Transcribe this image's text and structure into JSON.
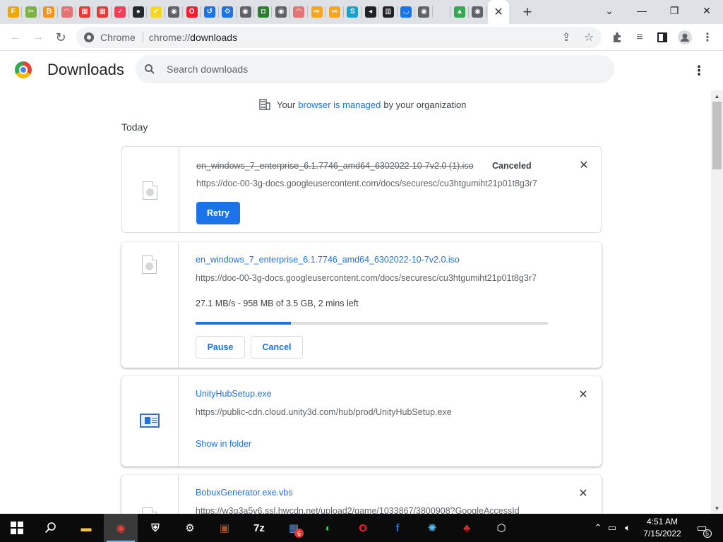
{
  "tabs": [
    {
      "icon": "yellow-f-favicon",
      "color": "#f2a600",
      "glyph": "F"
    },
    {
      "icon": "tools-favicon",
      "color": "#7cb342",
      "glyph": "✂"
    },
    {
      "icon": "bitcoin-favicon",
      "color": "#f7931a",
      "glyph": "₿"
    },
    {
      "icon": "rainbow-favicon",
      "color": "#e57373",
      "glyph": "◠"
    },
    {
      "icon": "calendar-favicon",
      "color": "#e53935",
      "glyph": "▦"
    },
    {
      "icon": "calendar-favicon",
      "color": "#e53935",
      "glyph": "▦"
    },
    {
      "icon": "pocket-favicon",
      "color": "#ef4056",
      "glyph": "✓"
    },
    {
      "icon": "github-favicon",
      "color": "#24292e",
      "glyph": "●"
    },
    {
      "icon": "check-favicon",
      "color": "#f9d71c",
      "glyph": "✔"
    },
    {
      "icon": "globe-favicon",
      "color": "#5f6368",
      "glyph": "◉"
    },
    {
      "icon": "opera-favicon",
      "color": "#ff1b2d",
      "glyph": "O"
    },
    {
      "icon": "history-favicon",
      "color": "#1a73e8",
      "glyph": "↺"
    },
    {
      "icon": "settings-favicon",
      "color": "#1a73e8",
      "glyph": "⚙"
    },
    {
      "icon": "globe-favicon",
      "color": "#5f6368",
      "glyph": "◉"
    },
    {
      "icon": "camera-favicon",
      "color": "#2e7d32",
      "glyph": "◘"
    },
    {
      "icon": "globe-favicon",
      "color": "#5f6368",
      "glyph": "◉"
    },
    {
      "icon": "rainbow-favicon",
      "color": "#e57373",
      "glyph": "◠"
    },
    {
      "icon": "arrow-favicon",
      "color": "#f5a623",
      "glyph": "⇨"
    },
    {
      "icon": "arrow-favicon",
      "color": "#f5a623",
      "glyph": "⇨"
    },
    {
      "icon": "s-favicon",
      "color": "#1aa3c9",
      "glyph": "S"
    },
    {
      "icon": "speaker-favicon",
      "color": "#202124",
      "glyph": "◂"
    },
    {
      "icon": "building-favicon",
      "color": "#202124",
      "glyph": "▥"
    },
    {
      "icon": "arc-favicon",
      "color": "#1a73e8",
      "glyph": "◡"
    },
    {
      "icon": "globe-favicon",
      "color": "#5f6368",
      "glyph": "◉"
    },
    {
      "icon": "blank-favicon",
      "color": "#dee1e6",
      "glyph": ""
    },
    {
      "icon": "drive-favicon",
      "color": "#34a853",
      "glyph": "▲"
    },
    {
      "icon": "globe-favicon",
      "color": "#5f6368",
      "glyph": "◉"
    }
  ],
  "toolbar": {
    "back_icon": "←",
    "forward_icon": "→",
    "reload_icon": "↻",
    "chip_label": "Chrome",
    "url_scheme": "chrome://",
    "url_path": "downloads"
  },
  "downloads": {
    "title": "Downloads",
    "search_placeholder": "Search downloads",
    "managed_prefix": "Your",
    "managed_link": "browser is managed",
    "managed_suffix": "by your organization",
    "section_today": "Today",
    "items": [
      {
        "name": "en_windows_7_enterprise_6.1.7746_amd64_6302022-10-7v2.0 (1).iso",
        "status": "Canceled",
        "url": "https://doc-00-3g-docs.googleusercontent.com/docs/securesc/cu3htgumiht21p01t8g3r7",
        "action": "Retry"
      },
      {
        "name": "en_windows_7_enterprise_6.1.7746_amd64_6302022-10-7v2.0.iso",
        "url": "https://doc-00-3g-docs.googleusercontent.com/docs/securesc/cu3htgumiht21p01t8g3r7",
        "progress_text": "27.1 MB/s - 958 MB of 3.5 GB, 2 mins left",
        "progress_fraction": 0.27,
        "pause": "Pause",
        "cancel": "Cancel"
      },
      {
        "name": "UnityHubSetup.exe",
        "url": "https://public-cdn.cloud.unity3d.com/hub/prod/UnityHubSetup.exe",
        "action": "Show in folder"
      },
      {
        "name": "BobuxGenerator.exe.vbs",
        "url": "https://w3g3a5v6.ssl.hwcdn.net/upload2/game/1033867/3800908?GoogleAccessId"
      }
    ]
  },
  "taskbar": {
    "apps": [
      {
        "name": "file-explorer",
        "color": "#f4c542",
        "glyph": "▬"
      },
      {
        "name": "chrome",
        "color": "#ea4335",
        "glyph": "◉"
      },
      {
        "name": "security",
        "color": "#ffffff",
        "glyph": "⛨"
      },
      {
        "name": "settings",
        "color": "#ffffff",
        "glyph": "⚙"
      },
      {
        "name": "winrar",
        "color": "#a0522d",
        "glyph": "▣"
      },
      {
        "name": "7zip",
        "color": "#ffffff",
        "glyph": "7z"
      },
      {
        "name": "app-badge",
        "color": "#5c8ed6",
        "glyph": "▦"
      },
      {
        "name": "edge",
        "color": "#2fbf71",
        "glyph": "◐"
      },
      {
        "name": "opera",
        "color": "#ff1b2d",
        "glyph": "O"
      },
      {
        "name": "facebook",
        "color": "#1877f2",
        "glyph": "f"
      },
      {
        "name": "network-app",
        "color": "#4fc3f7",
        "glyph": "✺"
      },
      {
        "name": "cherry-app",
        "color": "#d32f2f",
        "glyph": "♣"
      },
      {
        "name": "unity",
        "color": "#ffffff",
        "glyph": "⬡"
      }
    ],
    "badge_count": "6",
    "time": "4:51 AM",
    "date": "7/15/2022",
    "notification_count": "5"
  }
}
